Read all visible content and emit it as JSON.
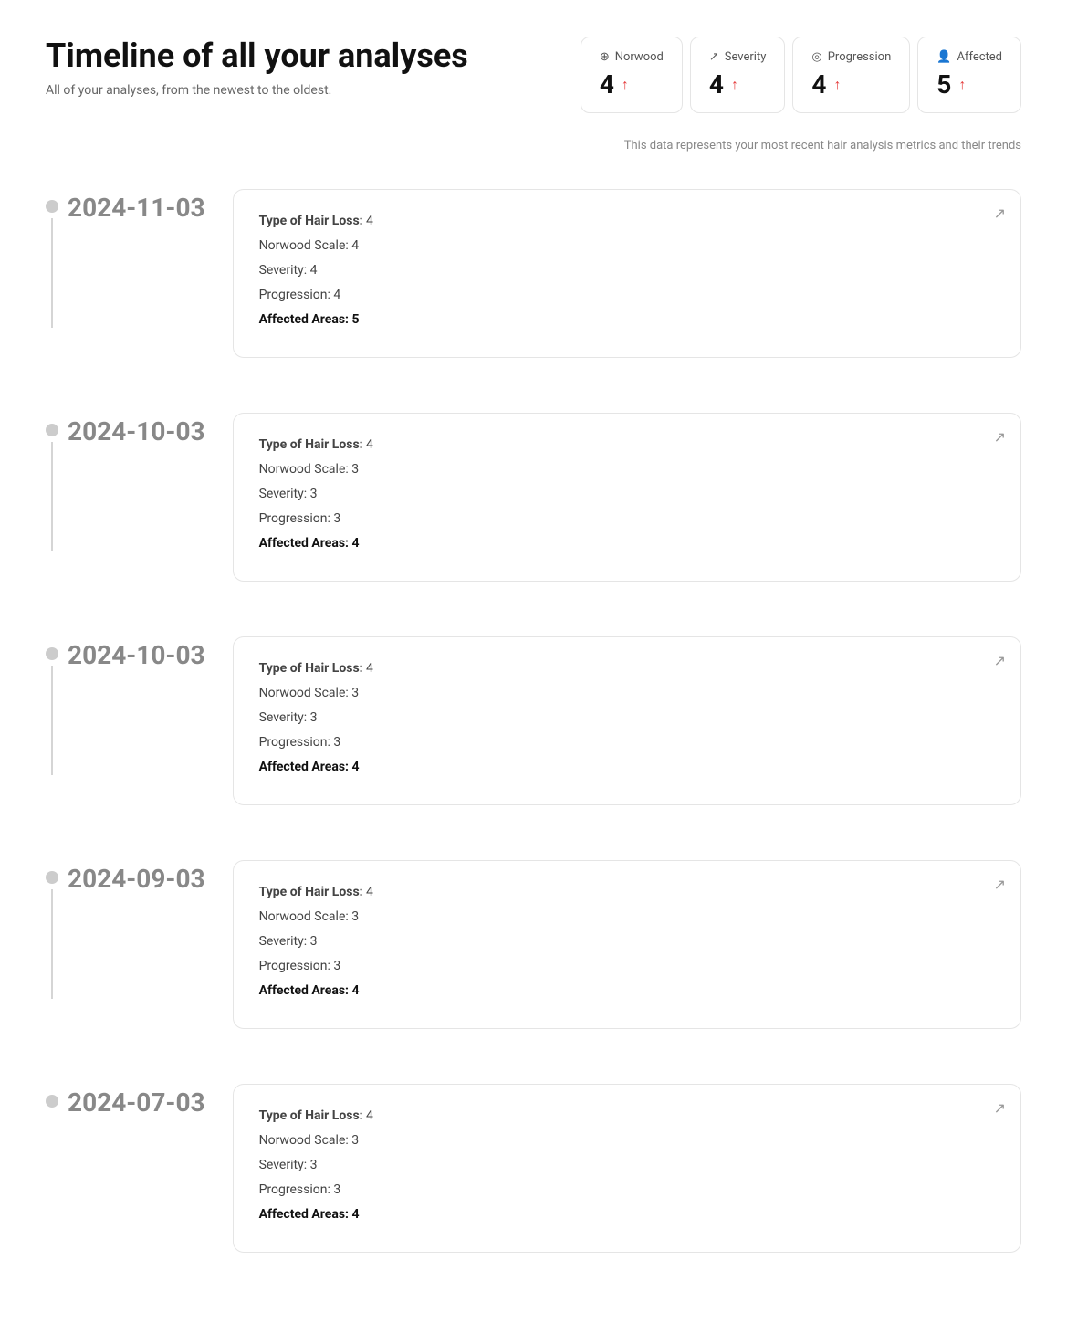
{
  "page": {
    "title": "Timeline of all your analyses",
    "subtitle": "All of your analyses, from the newest to the oldest.",
    "data_note": "This data represents your most recent hair analysis metrics and their trends"
  },
  "metrics": [
    {
      "id": "norwood",
      "label": "Norwood",
      "icon": "⊕",
      "value": "4",
      "trend": "↑"
    },
    {
      "id": "severity",
      "label": "Severity",
      "icon": "↗",
      "value": "4",
      "trend": "↑"
    },
    {
      "id": "progression",
      "label": "Progression",
      "icon": "◎",
      "value": "4",
      "trend": "↑"
    },
    {
      "id": "affected",
      "label": "Affected",
      "icon": "👤",
      "value": "5",
      "trend": "↑"
    }
  ],
  "timeline": [
    {
      "date": "2024-11-03",
      "type_of_hair_loss": 4,
      "norwood_scale": 4,
      "severity": 4,
      "progression": 4,
      "affected_areas": 5,
      "labels": {
        "type": "Type of Hair Loss:",
        "norwood": "Norwood Scale:",
        "severity": "Severity:",
        "progression": "Progression:",
        "affected": "Affected Areas:"
      }
    },
    {
      "date": "2024-10-03",
      "type_of_hair_loss": 4,
      "norwood_scale": 3,
      "severity": 3,
      "progression": 3,
      "affected_areas": 4,
      "labels": {
        "type": "Type of Hair Loss:",
        "norwood": "Norwood Scale:",
        "severity": "Severity:",
        "progression": "Progression:",
        "affected": "Affected Areas:"
      }
    },
    {
      "date": "2024-10-03",
      "type_of_hair_loss": 4,
      "norwood_scale": 3,
      "severity": 3,
      "progression": 3,
      "affected_areas": 4,
      "labels": {
        "type": "Type of Hair Loss:",
        "norwood": "Norwood Scale:",
        "severity": "Severity:",
        "progression": "Progression:",
        "affected": "Affected Areas:"
      }
    },
    {
      "date": "2024-09-03",
      "type_of_hair_loss": 4,
      "norwood_scale": 3,
      "severity": 3,
      "progression": 3,
      "affected_areas": 4,
      "labels": {
        "type": "Type of Hair Loss:",
        "norwood": "Norwood Scale:",
        "severity": "Severity:",
        "progression": "Progression:",
        "affected": "Affected Areas:"
      }
    },
    {
      "date": "2024-07-03",
      "type_of_hair_loss": 4,
      "norwood_scale": 3,
      "severity": 3,
      "progression": 3,
      "affected_areas": 4,
      "labels": {
        "type": "Type of Hair Loss:",
        "norwood": "Norwood Scale:",
        "severity": "Severity:",
        "progression": "Progression:",
        "affected": "Affected Areas:"
      }
    }
  ],
  "link_icon": "↗"
}
